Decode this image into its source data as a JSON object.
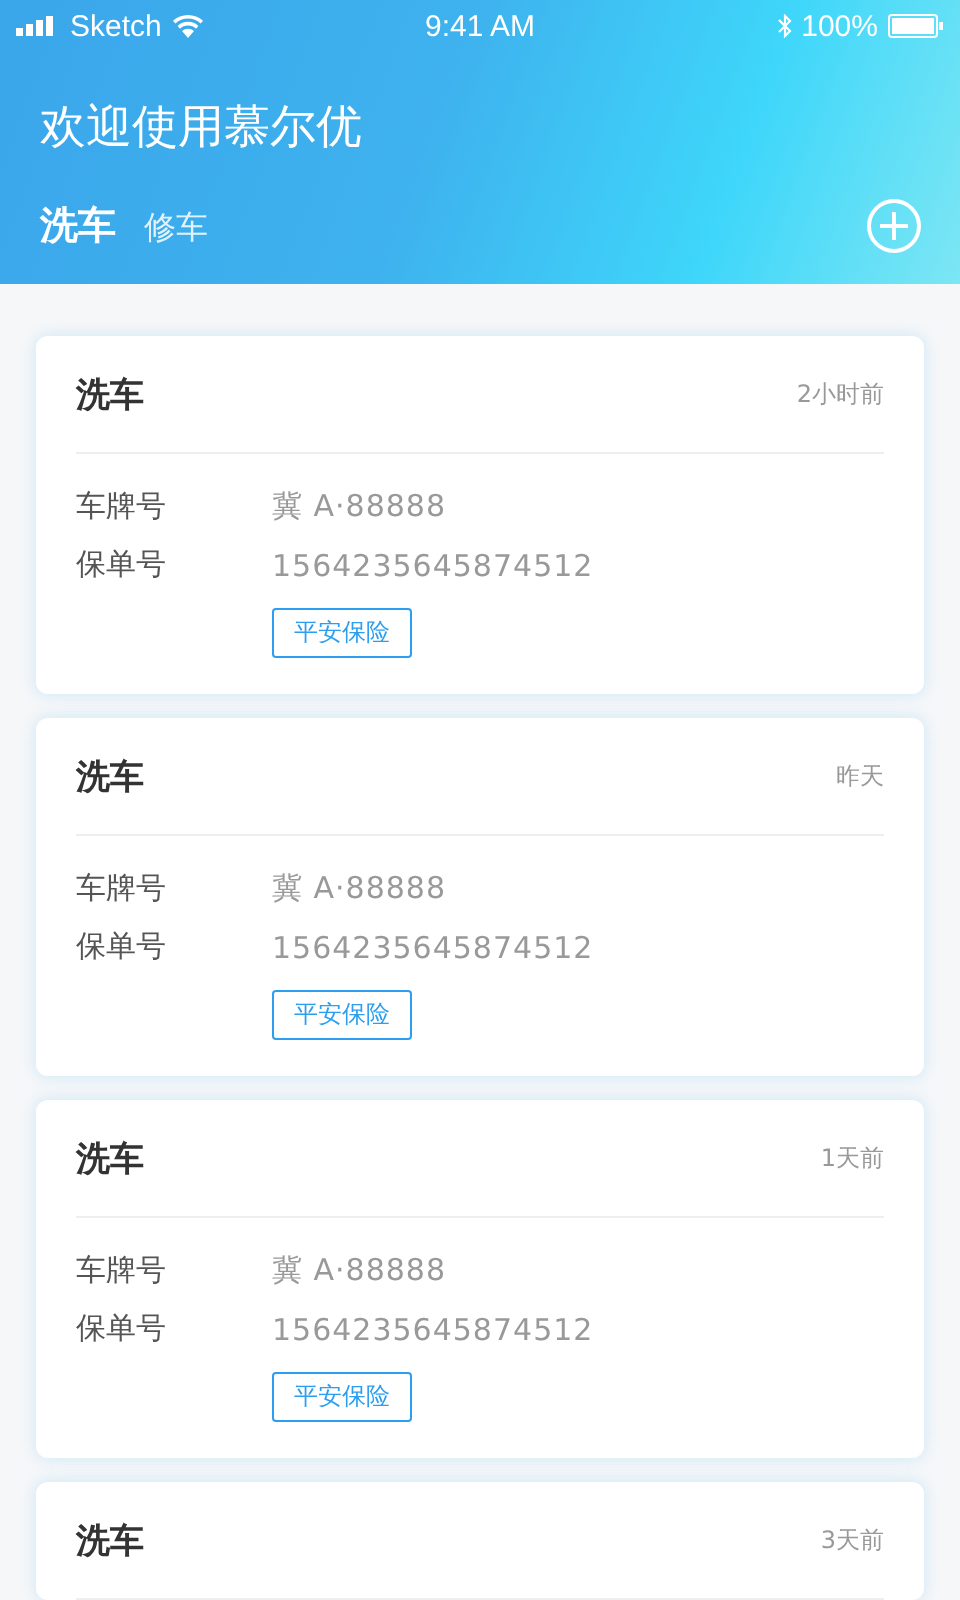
{
  "status_bar": {
    "carrier": "Sketch",
    "time": "9:41 AM",
    "battery": "100%"
  },
  "header": {
    "title": "欢迎使用慕尔优"
  },
  "tabs": [
    {
      "label": "洗车",
      "selected": true
    },
    {
      "label": "修车",
      "selected": false
    }
  ],
  "cards": [
    {
      "title": "洗车",
      "time": "2小时前",
      "fields": [
        {
          "label": "车牌号",
          "value": "冀 A·88888"
        },
        {
          "label": "保单号",
          "value": "1564235645874512"
        }
      ],
      "tag": "平安保险"
    },
    {
      "title": "洗车",
      "time": "昨天",
      "fields": [
        {
          "label": "车牌号",
          "value": "冀 A·88888"
        },
        {
          "label": "保单号",
          "value": "1564235645874512"
        }
      ],
      "tag": "平安保险"
    },
    {
      "title": "洗车",
      "time": "1天前",
      "fields": [
        {
          "label": "车牌号",
          "value": "冀 A·88888"
        },
        {
          "label": "保单号",
          "value": "1564235645874512"
        }
      ],
      "tag": "平安保险"
    },
    {
      "title": "洗车",
      "time": "3天前"
    }
  ]
}
